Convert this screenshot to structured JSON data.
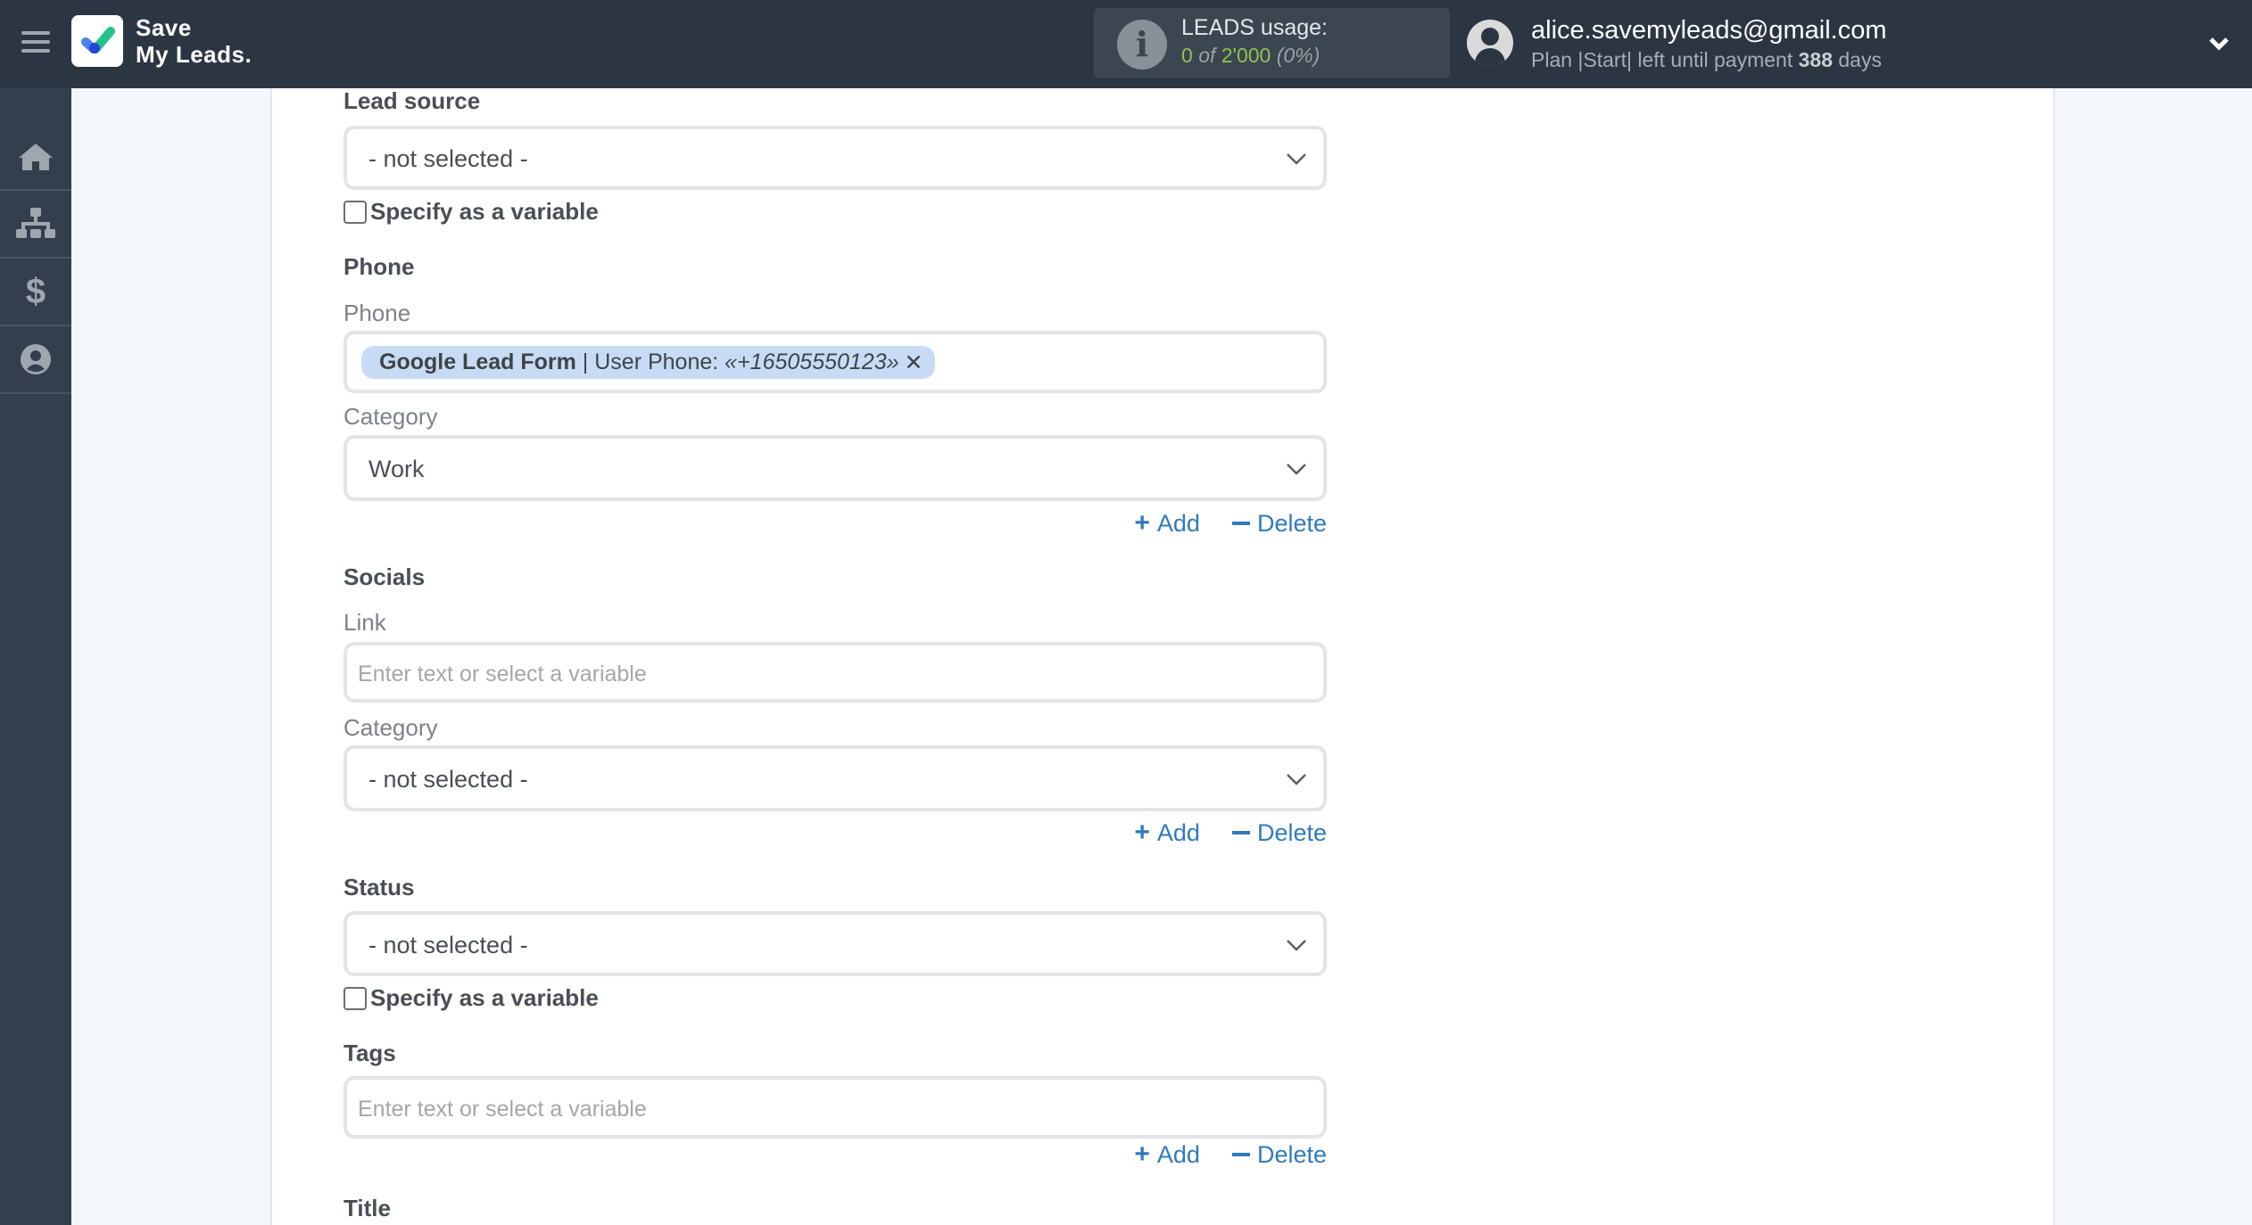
{
  "header": {
    "brand_line1": "Save",
    "brand_line2": "My Leads.",
    "usage": {
      "title": "LEADS usage:",
      "used": "0",
      "of": "of",
      "total": "2'000",
      "percent": "(0%)"
    },
    "account": {
      "email": "alice.savemyleads@gmail.com",
      "plan_prefix": "Plan |Start| left until payment",
      "days": "388",
      "days_suffix": "days"
    }
  },
  "sidebar": {
    "items": [
      {
        "name": "home",
        "icon": "home-icon"
      },
      {
        "name": "connections",
        "icon": "sitemap-icon"
      },
      {
        "name": "billing",
        "icon": "dollar-icon"
      },
      {
        "name": "account",
        "icon": "user-circle-icon"
      }
    ]
  },
  "form": {
    "lead_source": {
      "label": "Lead source",
      "value": "- not selected -",
      "specify_label": "Specify as a variable"
    },
    "phone": {
      "heading": "Phone",
      "sublabel": "Phone",
      "tag": {
        "source": "Google Lead Form",
        "separator": " | ",
        "field": "User Phone: ",
        "value": "«+16505550123»",
        "remove": "✕"
      },
      "category_label": "Category",
      "category_value": "Work"
    },
    "socials": {
      "heading": "Socials",
      "link_label": "Link",
      "link_placeholder": "Enter text or select a variable",
      "category_label": "Category",
      "category_value": "- not selected -"
    },
    "status": {
      "label": "Status",
      "value": "- not selected -",
      "specify_label": "Specify as a variable"
    },
    "tags": {
      "label": "Tags",
      "placeholder": "Enter text or select a variable"
    },
    "title": {
      "label": "Title"
    },
    "add_label": "Add",
    "delete_label": "Delete"
  }
}
